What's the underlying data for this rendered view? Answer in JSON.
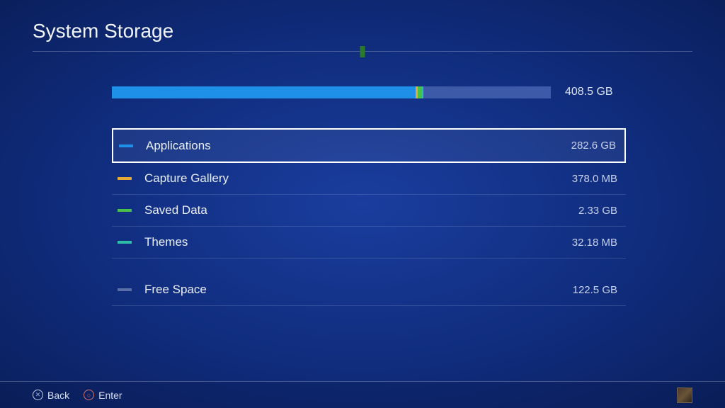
{
  "header": {
    "title": "System Storage"
  },
  "storage": {
    "total": "408.5 GB",
    "categories": [
      {
        "key": "applications",
        "label": "Applications",
        "size": "282.6 GB",
        "indicatorClass": "ind-apps",
        "selected": true
      },
      {
        "key": "capture_gallery",
        "label": "Capture Gallery",
        "size": "378.0 MB",
        "indicatorClass": "ind-capture",
        "selected": false
      },
      {
        "key": "saved_data",
        "label": "Saved Data",
        "size": "2.33 GB",
        "indicatorClass": "ind-saved",
        "selected": false
      },
      {
        "key": "themes",
        "label": "Themes",
        "size": "32.18 MB",
        "indicatorClass": "ind-themes",
        "selected": false
      },
      {
        "key": "free_space",
        "label": "Free Space",
        "size": "122.5 GB",
        "indicatorClass": "ind-free",
        "selected": false,
        "gap": true
      }
    ]
  },
  "footer": {
    "back_label": "Back",
    "enter_label": "Enter"
  }
}
